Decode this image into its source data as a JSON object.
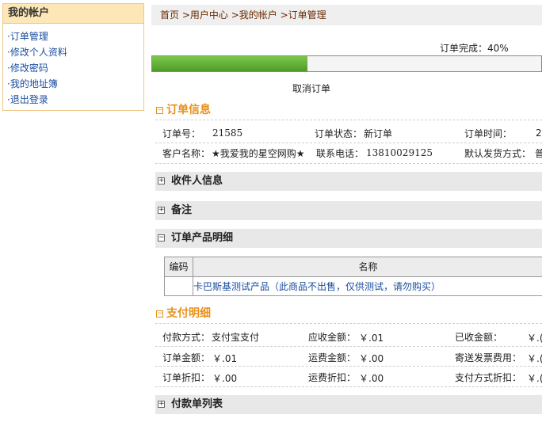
{
  "sidebar": {
    "title": "我的帐户",
    "items": [
      {
        "label": "·订单管理"
      },
      {
        "label": "·修改个人资料"
      },
      {
        "label": "·修改密码"
      },
      {
        "label": "·我的地址簿"
      },
      {
        "label": "·退出登录"
      }
    ]
  },
  "breadcrumb": {
    "home": "首页",
    "sep": " >",
    "user_center": "用户中心",
    "my_account": "我的帐户",
    "order_mgmt": "订单管理"
  },
  "progress": {
    "label": "订单完成：40%",
    "fraction": 0.4
  },
  "cancel_order": "取消订单",
  "order_info": {
    "title": "订单信息",
    "order_no_label": "订单号：",
    "order_no": "21585",
    "status_label": "订单状态：",
    "status": "新订单",
    "time_label": "订单时间：",
    "time_value": "2",
    "customer_label": "客户名称：",
    "customer": "★我爱我的星空网购★",
    "phone_label": "联系电话：",
    "phone": "13810029125",
    "ship_label": "默认发货方式：",
    "ship_value": "普"
  },
  "sections": {
    "receiver": "收件人信息",
    "remark": "备注",
    "products": "订单产品明细",
    "payment_list": "付款单列表"
  },
  "product_table": {
    "col_code": "编码",
    "col_name": "名称",
    "rows": [
      {
        "code": "",
        "name": "卡巴斯基测试产品（此商品不出售，仅供测试，请勿购买）"
      }
    ]
  },
  "payment": {
    "title": "支付明细",
    "pay_method_label": "付款方式：",
    "pay_method": "支付宝支付",
    "due_label": "应收金额：",
    "due": "￥.01",
    "received_label": "已收金额：",
    "received": "￥.(",
    "order_amt_label": "订单金额：",
    "order_amt": "￥.01",
    "freight_label": "运费金额：",
    "freight": "￥.00",
    "invoice_label": "寄送发票费用：",
    "invoice": "￥.(",
    "order_disc_label": "订单折扣：",
    "order_disc": "￥.00",
    "freight_disc_label": "运费折扣：",
    "freight_disc": "￥.00",
    "method_disc_label": "支付方式折扣：",
    "method_disc": "￥.("
  },
  "colors": {
    "accent_orange": "#e8901a",
    "link_blue": "#1a4d9e",
    "progress_green": "#5aa832",
    "sidebar_header": "#fde7b6"
  }
}
